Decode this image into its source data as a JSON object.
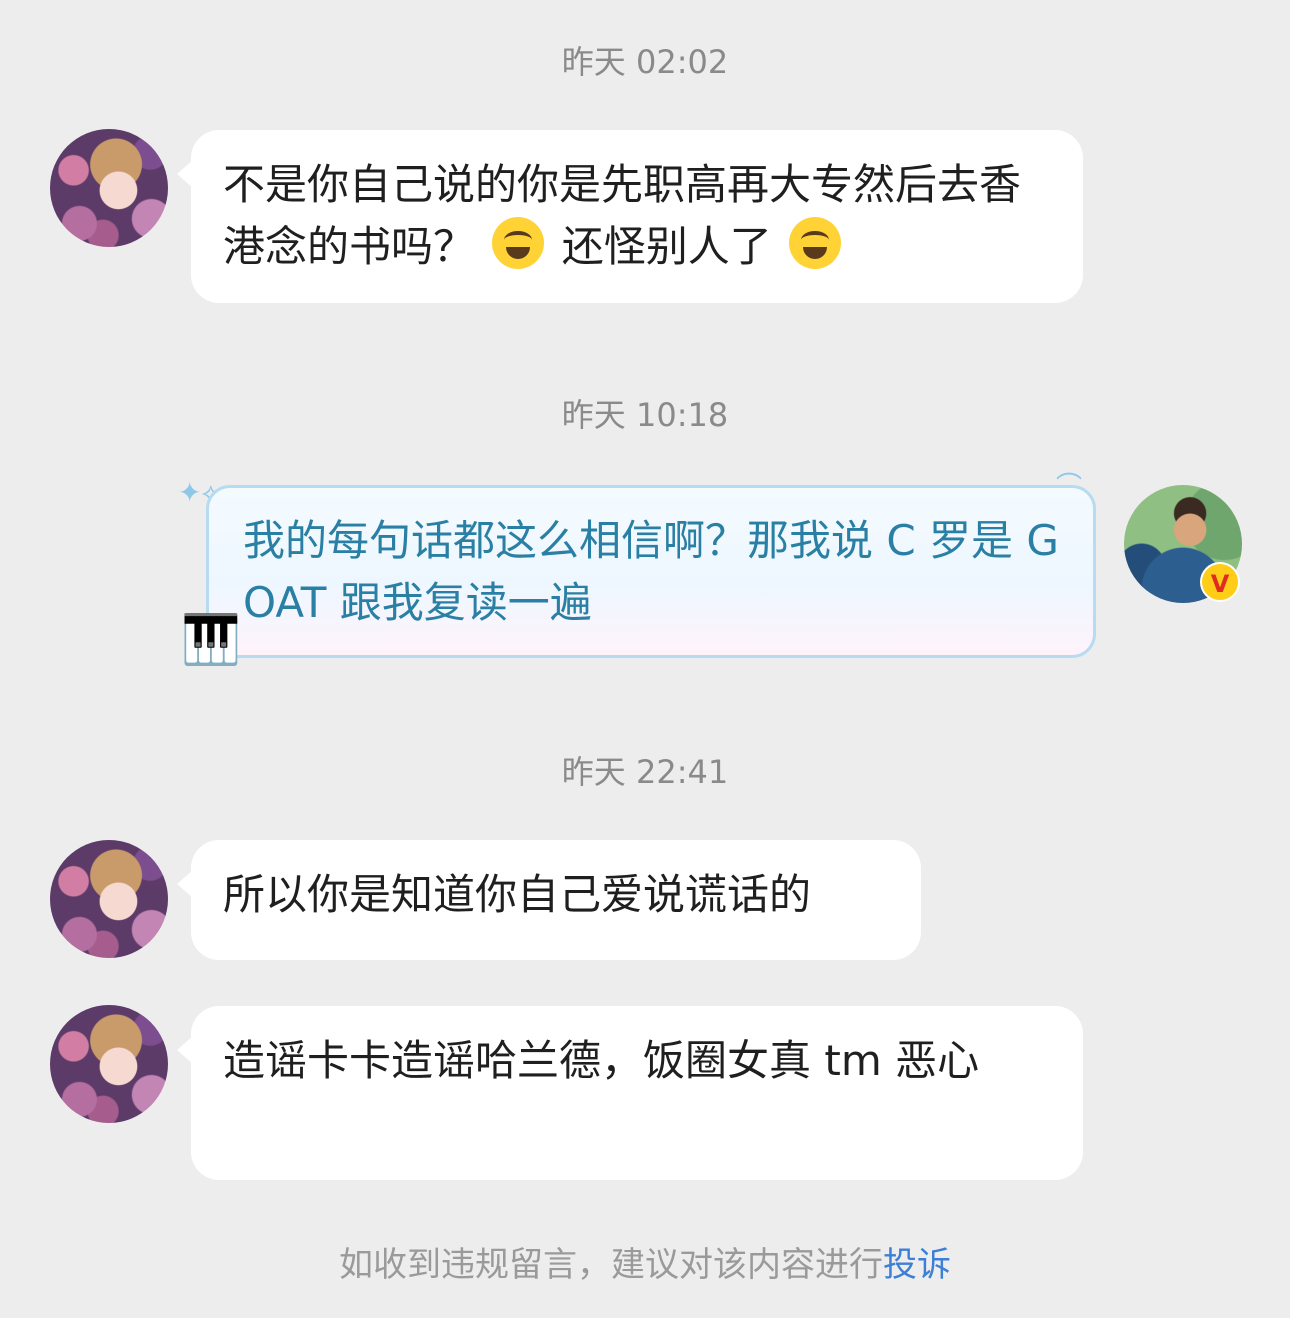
{
  "messages": [
    {
      "timestamp": "昨天 02:02",
      "sender": "left",
      "text_before_emoji": "不是你自己说的你是先职高再大专然后去香港念的书吗？",
      "emoji_1": "laughing-crying-emoji",
      "text_middle": "还怪别人了",
      "emoji_2": "laughing-crying-emoji"
    },
    {
      "timestamp": "昨天 10:18",
      "sender": "right",
      "text": "我的每句话都这么相信啊？那我说 C 罗是 GOAT 跟我复读一遍"
    },
    {
      "timestamp": "昨天 22:41",
      "sender": "left",
      "text": "所以你是知道你自己爱说谎话的"
    },
    {
      "sender": "left",
      "text": "造谣卡卡造谣哈兰德，饭圈女真 tm 恶心"
    }
  ],
  "badge": {
    "verified_label": "V"
  },
  "footer": {
    "prefix": "如收到违规留言，建议对该内容进行",
    "link": "投诉"
  }
}
